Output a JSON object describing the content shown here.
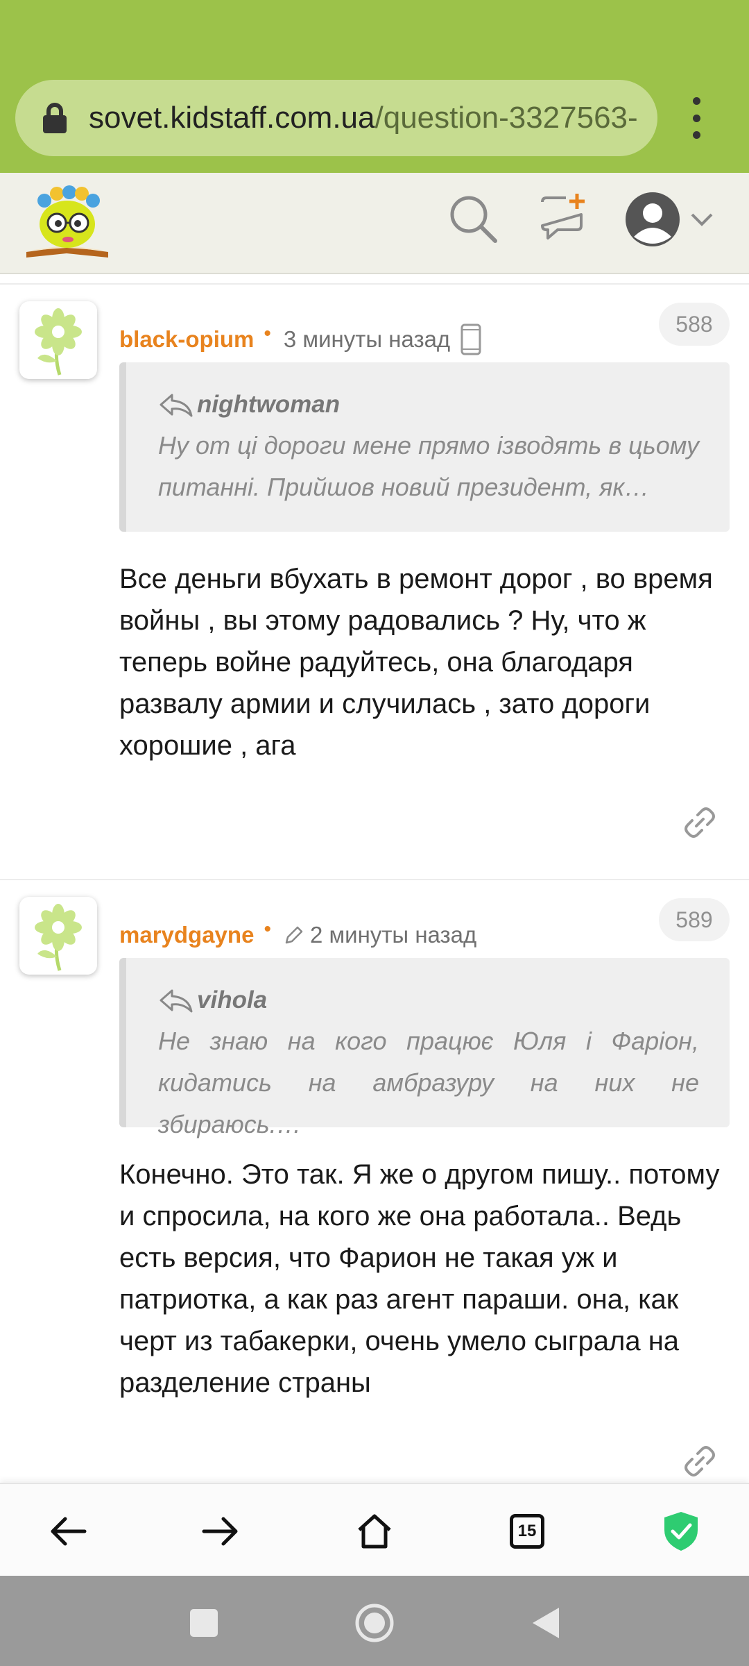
{
  "browser": {
    "url_host": "sovet.kidstaff.com.ua",
    "url_path": "/question-3327563-",
    "tab_count": "15"
  },
  "site_header": {
    "logo_icon": "kidstaff-logo-icon",
    "search_icon": "search-icon",
    "new_message_icon": "add-comment-icon",
    "profile_icon": "avatar-icon"
  },
  "comments": [
    {
      "author": "black-opium",
      "time": "3 минуты назад",
      "device_icon": "mobile-phone-icon",
      "number": "588",
      "quote_author": "nightwoman",
      "quote_text": "Ну от ці дороги мене прямо ізводять в цьому питанні. Прийшов новий президент, як…",
      "body": "Все деньги вбухать в ремонт дорог , во время войны , вы этому радовались ? Ну, что ж теперь войне радуйтесь, она благодаря развалу армии и случилась , зато дороги хорошие , ага"
    },
    {
      "author": "marydgayne",
      "time": "2 минуты назад",
      "device_icon": "pencil-icon",
      "number": "589",
      "quote_author": "vihola",
      "quote_text": "Не знаю на кого працює Юля і Фаріон, кидатись на амбразуру на них не збираюсь.…",
      "body": "Конечно. Это так. Я же о другом пишу.. потому и спросила, на кого же она работала.. Ведь есть версия, что Фарион не такая уж и патриотка, а как раз агент параши. она, как черт из табакерки, очень умело сыграла на разделение страны"
    }
  ],
  "colors": {
    "chrome_green": "#9cc24a",
    "author_orange": "#e8831e",
    "shield_green": "#2ecc71"
  }
}
